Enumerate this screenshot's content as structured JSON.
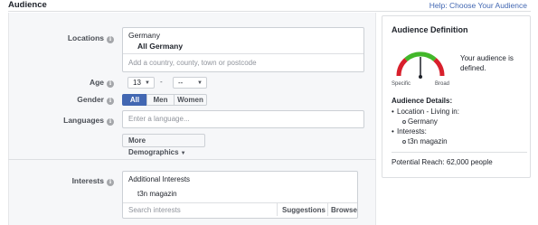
{
  "header": {
    "title": "Audience",
    "help_link": "Help: Choose Your Audience"
  },
  "locations": {
    "label": "Locations",
    "country": "Germany",
    "selection": "All Germany",
    "placeholder": "Add a country, county, town or postcode"
  },
  "age": {
    "label": "Age",
    "min": "13",
    "max": "--",
    "separator": "-",
    "caret": "▼"
  },
  "gender": {
    "label": "Gender",
    "options": [
      "All",
      "Men",
      "Women"
    ],
    "selected": "All"
  },
  "languages": {
    "label": "Languages",
    "placeholder": "Enter a language..."
  },
  "more_demographics": {
    "label": "More Demographics",
    "caret": "▼"
  },
  "interests": {
    "label": "Interests",
    "group_title": "Additional Interests",
    "items": [
      "t3n magazin"
    ],
    "search_placeholder": "Search interests",
    "suggestions_label": "Suggestions",
    "browse_label": "Browse"
  },
  "audience_definition": {
    "title": "Audience Definition",
    "gauge_status": "Your audience is defined.",
    "gauge_left_label": "Specific",
    "gauge_right_label": "Broad",
    "gauge_level": 0.5,
    "details_title": "Audience Details:",
    "details": [
      {
        "label": "Location - Living in:",
        "values": [
          "Germany"
        ]
      },
      {
        "label": "Interests:",
        "values": [
          "t3n magazin"
        ]
      }
    ],
    "potential_reach": "Potential Reach: 62,000 people"
  },
  "colors": {
    "accent": "#4267b2",
    "gauge_red": "#d8202c",
    "gauge_green": "#42b72a"
  },
  "icons": {
    "info": "i",
    "bullet": "•"
  }
}
